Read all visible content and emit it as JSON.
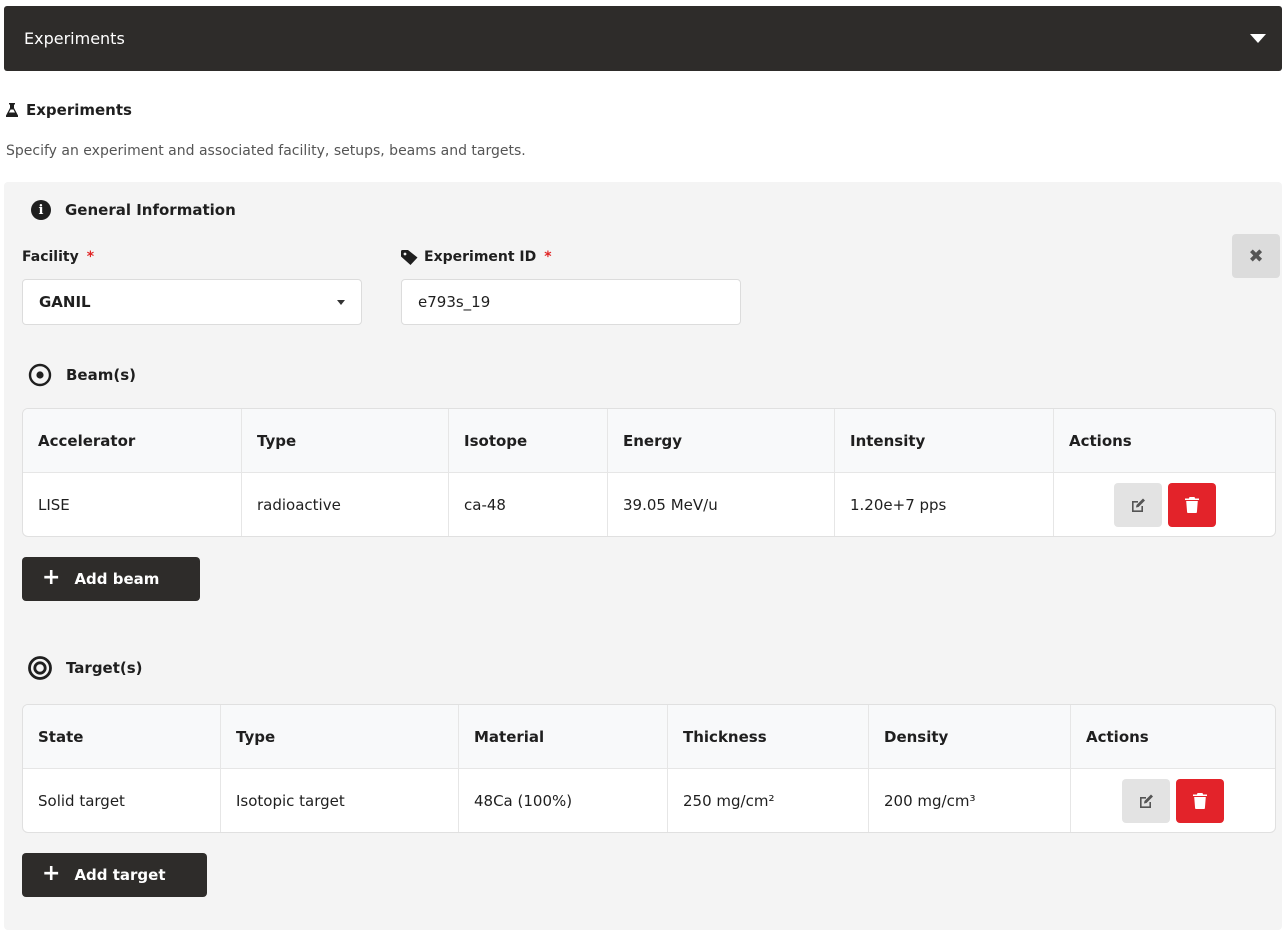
{
  "accordion": {
    "title": "Experiments"
  },
  "section": {
    "title": "Experiments",
    "description": "Specify an experiment and associated facility, setups, beams and targets."
  },
  "general": {
    "title": "General Information",
    "facility_label": "Facility",
    "facility_value": "GANIL",
    "experiment_id_label": "Experiment ID",
    "experiment_id_value": "e793s_19",
    "required_mark": "*"
  },
  "close_button": "✖",
  "beams": {
    "title": "Beam(s)",
    "columns": [
      "Accelerator",
      "Type",
      "Isotope",
      "Energy",
      "Intensity",
      "Actions"
    ],
    "rows": [
      [
        "LISE",
        "radioactive",
        "ca-48",
        "39.05 MeV/u",
        "1.20e+7 pps"
      ]
    ],
    "add_label": "Add beam"
  },
  "targets": {
    "title": "Target(s)",
    "columns": [
      "State",
      "Type",
      "Material",
      "Thickness",
      "Density",
      "Actions"
    ],
    "rows": [
      [
        "Solid target",
        "Isotopic target",
        "48Ca (100%)",
        "250 mg/cm²",
        "200 mg/cm³"
      ]
    ],
    "add_label": "Add target"
  },
  "colors": {
    "header_bg": "#2e2c2a",
    "panel_bg": "#f4f4f4",
    "delete": "#e3232a",
    "required": "#e02424"
  },
  "icons": [
    "caret-down-icon",
    "flask-icon",
    "info-icon",
    "tag-icon",
    "dot-circle-icon",
    "bullseye-icon",
    "edit-icon",
    "trash-icon",
    "close-icon",
    "plus-icon"
  ]
}
